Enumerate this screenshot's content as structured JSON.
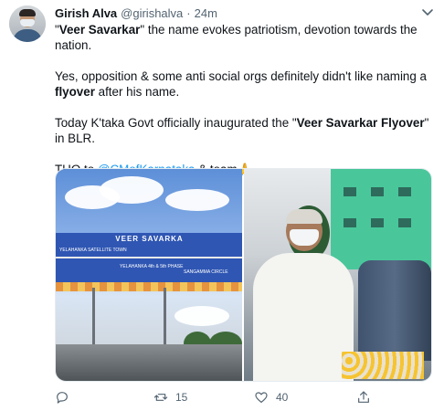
{
  "tweet": {
    "author": {
      "name": "Girish Alva",
      "handle": "@girishalva",
      "separator": "·",
      "time": "24m"
    },
    "body": {
      "line1_prefix": "\"",
      "line1_bold": "Veer Savarkar",
      "line1_rest": "\" the name evokes patriotism, devotion towards the nation.",
      "line2_prefix": "Yes, opposition & some anti social orgs definitely didn't like naming a ",
      "line2_bold": "flyover",
      "line2_rest": " after his name.",
      "line3_prefix": "Today K'taka Govt officially inaugurated the \"",
      "line3_bold": "Veer Savarkar Flyover",
      "line3_rest": "\" in BLR.",
      "line4_prefix": "THQ to ",
      "line4_mention": "@CMofKarnataka",
      "line4_rest": " & team",
      "line4_emoji": "🙏"
    },
    "media": {
      "left_photo": {
        "sign_title": "VEER SAVARKA",
        "sign_left": "YELAHANKA SATELLITE TOWN",
        "sign_mid": "YELAHANKA 4th & 5th PHASE",
        "sign_right": "SANGAMMA CIRCLE"
      }
    },
    "actions": {
      "reply_icon": "reply-icon",
      "retweet_icon": "retweet-icon",
      "retweet_count": "15",
      "like_icon": "heart-icon",
      "like_count": "40",
      "share_icon": "share-icon"
    },
    "colors": {
      "mention": "#1d9bf0",
      "secondary_text": "#536471"
    }
  }
}
